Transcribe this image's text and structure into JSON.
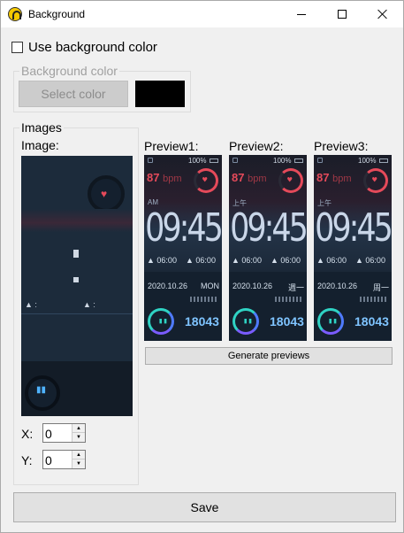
{
  "window": {
    "title": "Background",
    "icon": "app-logo-icon"
  },
  "options": {
    "use_bg_color_label": "Use background color",
    "use_bg_color_checked": false
  },
  "bg_color": {
    "group_title": "Background color",
    "select_label": "Select color",
    "swatch_color": "#000000"
  },
  "images": {
    "group_title": "Images",
    "image_label": "Image:",
    "x_label": "X:",
    "x_value": "0",
    "y_label": "Y:",
    "y_value": "0"
  },
  "previews": [
    {
      "label": "Preview1:",
      "battery": "100%",
      "bpm": "87",
      "bpm_unit": "bpm",
      "ampm": "AM",
      "time": "09:45",
      "sunrise": "06:00",
      "sunset": "06:00",
      "date": "2020.10.26",
      "weekday": "MON",
      "steps": "18043"
    },
    {
      "label": "Preview2:",
      "battery": "100%",
      "bpm": "87",
      "bpm_unit": "bpm",
      "ampm": "上午",
      "time": "09:45",
      "sunrise": "06:00",
      "sunset": "06:00",
      "date": "2020.10.26",
      "weekday": "週一",
      "steps": "18043"
    },
    {
      "label": "Preview3:",
      "battery": "100%",
      "bpm": "87",
      "bpm_unit": "bpm",
      "ampm": "上午",
      "time": "09:45",
      "sunrise": "06:00",
      "sunset": "06:00",
      "date": "2020.10.26",
      "weekday": "周一",
      "steps": "18043"
    }
  ],
  "actions": {
    "generate_label": "Generate previews",
    "save_label": "Save"
  }
}
